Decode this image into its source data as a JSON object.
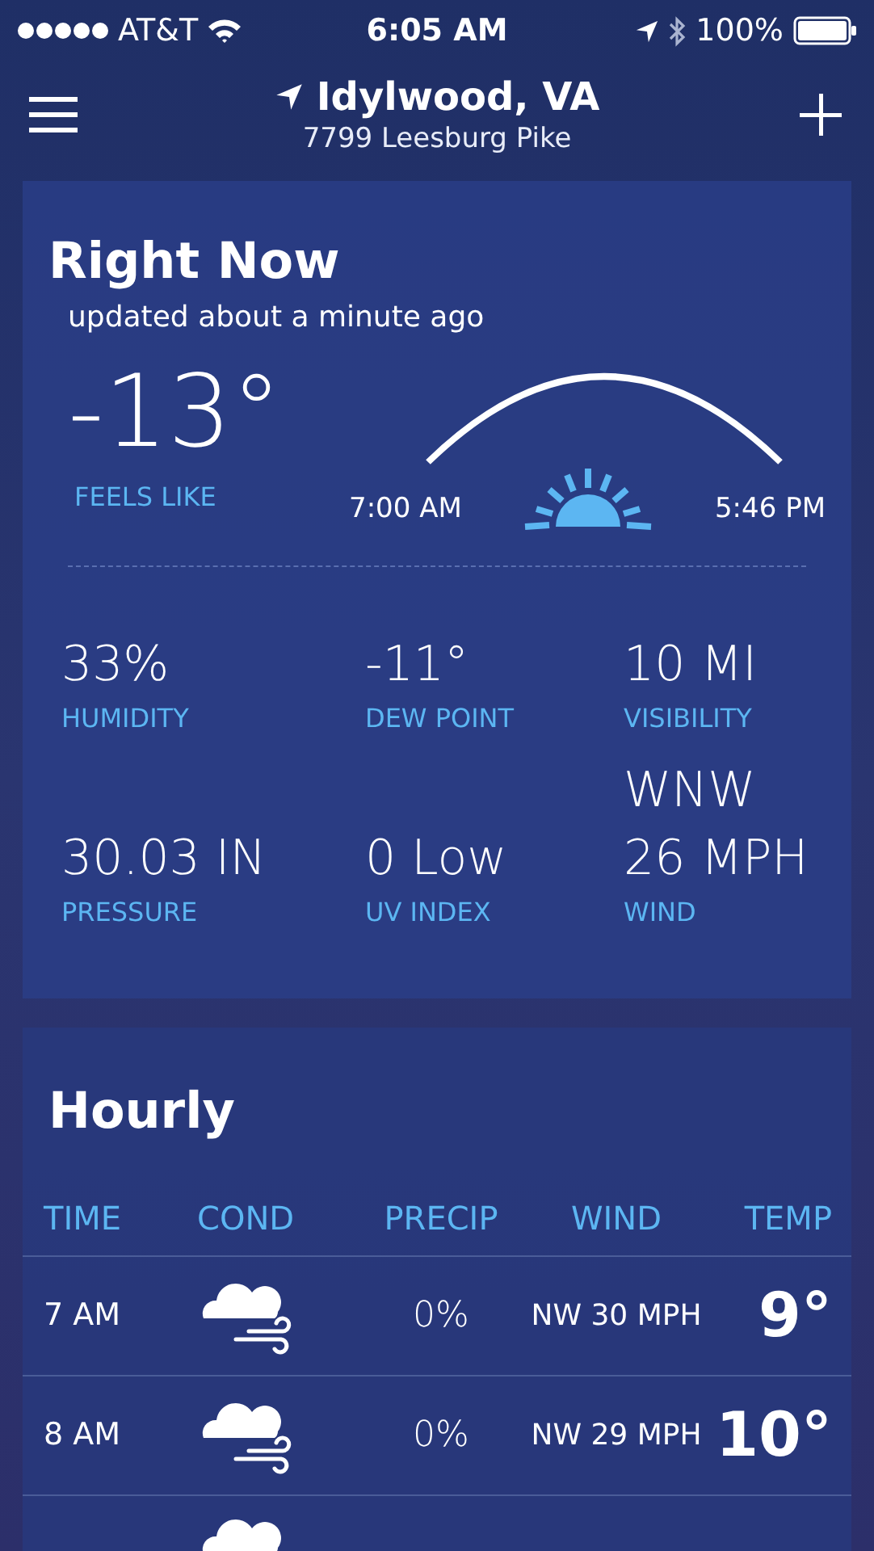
{
  "status_bar": {
    "carrier": "AT&T",
    "time": "6:05 AM",
    "battery": "100%"
  },
  "header": {
    "location": "Idylwood, VA",
    "address": "7799 Leesburg Pike"
  },
  "right_now": {
    "title": "Right Now",
    "updated": "updated about a minute ago",
    "temperature": "-13°",
    "temperature_label": "FEELS LIKE",
    "sunrise": "7:00 AM",
    "sunset": "5:46 PM",
    "details": [
      {
        "value": "33%",
        "label": "HUMIDITY"
      },
      {
        "value": "-11°",
        "label": "DEW POINT"
      },
      {
        "value": "10 MI",
        "label": "VISIBILITY"
      },
      {
        "value": "30.03 IN",
        "label": "PRESSURE"
      },
      {
        "value": "0 Low",
        "label": "UV INDEX"
      },
      {
        "value": "WNW 26 MPH",
        "label": "WIND"
      }
    ]
  },
  "hourly": {
    "title": "Hourly",
    "columns": [
      "TIME",
      "COND",
      "PRECIP",
      "WIND",
      "TEMP"
    ],
    "rows": [
      {
        "time": "7 AM",
        "precip": "0%",
        "wind": "NW 30 MPH",
        "temp": "9°"
      },
      {
        "time": "8 AM",
        "precip": "0%",
        "wind": "NW 29 MPH",
        "temp": "10°"
      }
    ]
  }
}
